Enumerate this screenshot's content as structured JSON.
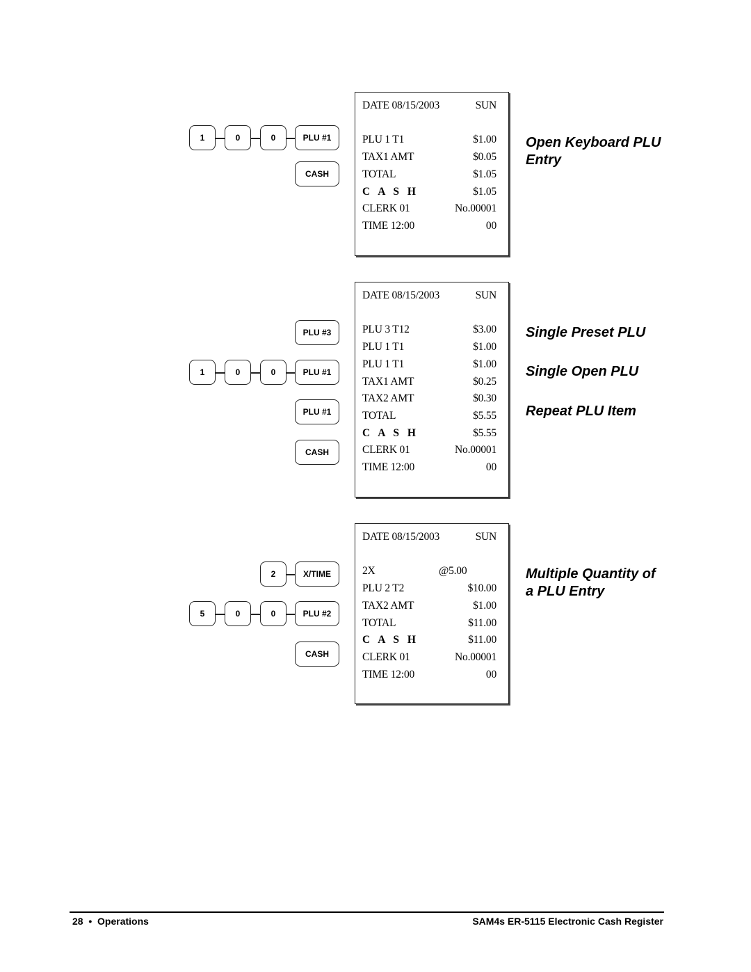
{
  "examples": [
    {
      "title_lines": [
        "Open Keyboard PLU",
        "Entry"
      ],
      "key_rows": [
        [
          "1",
          "0",
          "0",
          "PLU #1"
        ],
        [
          "CASH"
        ]
      ],
      "receipt": {
        "date_label": "DATE 08/15/2003",
        "day": "SUN",
        "lines": [
          {
            "left": "PLU 1 T1",
            "right": "$1.00"
          },
          {
            "left": "TAX1 AMT",
            "right": "$0.05"
          },
          {
            "left": "TOTAL",
            "right": "$1.05"
          },
          {
            "left": "C A S H",
            "right": "$1.05",
            "bold": true
          },
          {
            "left": "CLERK 01",
            "right": "No.00001"
          },
          {
            "left": "TIME 12:00",
            "right": "00"
          }
        ]
      }
    },
    {
      "title_lines": [
        "Single Preset PLU",
        "Single Open PLU",
        "Repeat PLU Item"
      ],
      "key_rows": [
        [
          "PLU #3"
        ],
        [
          "1",
          "0",
          "0",
          "PLU #1"
        ],
        [
          "PLU #1"
        ],
        [
          "CASH"
        ]
      ],
      "receipt": {
        "date_label": "DATE 08/15/2003",
        "day": "SUN",
        "lines": [
          {
            "left": "PLU 3 T12",
            "right": "$3.00"
          },
          {
            "left": "PLU 1 T1",
            "right": "$1.00"
          },
          {
            "left": "PLU 1 T1",
            "right": "$1.00"
          },
          {
            "left": "TAX1 AMT",
            "right": "$0.25"
          },
          {
            "left": "TAX2 AMT",
            "right": "$0.30"
          },
          {
            "left": "TOTAL",
            "right": "$5.55"
          },
          {
            "left": "C A S H",
            "right": "$5.55",
            "bold": true
          },
          {
            "left": "CLERK 01",
            "right": "No.00001"
          },
          {
            "left": "TIME 12:00",
            "right": "00"
          }
        ]
      }
    },
    {
      "title_lines": [
        "Multiple Quantity of",
        "a PLU Entry"
      ],
      "key_rows": [
        [
          "2",
          "X/TIME"
        ],
        [
          "5",
          "0",
          "0",
          "PLU #2"
        ],
        [
          "CASH"
        ]
      ],
      "receipt": {
        "date_label": "DATE 08/15/2003",
        "day": "SUN",
        "lines": [
          {
            "left": "2X",
            "right": "@5.00",
            "center": true
          },
          {
            "left": "PLU 2 T2",
            "right": "$10.00"
          },
          {
            "left": "TAX2 AMT",
            "right": "$1.00"
          },
          {
            "left": "TOTAL",
            "right": "$11.00"
          },
          {
            "left": "C A S H",
            "right": "$11.00",
            "bold": true
          },
          {
            "left": "CLERK 01",
            "right": "No.00001"
          },
          {
            "left": "TIME 12:00",
            "right": "00"
          }
        ]
      }
    }
  ],
  "footer": {
    "left": "28  •  Operations",
    "right": "SAM4s ER-5115 Electronic Cash Register"
  }
}
